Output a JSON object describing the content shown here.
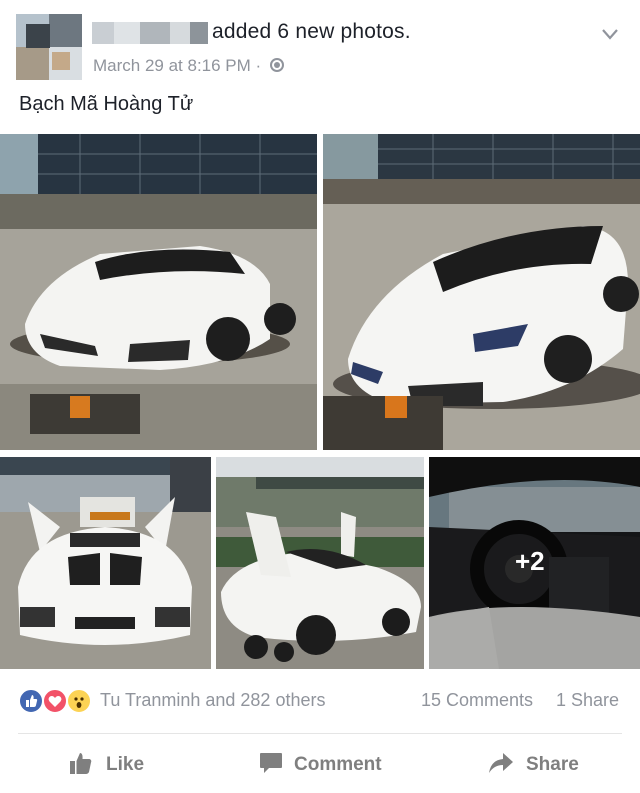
{
  "post": {
    "author_obscured": true,
    "action_text": "added 6 new photos.",
    "timestamp": "March 29 at 8:16 PM",
    "separator": "·",
    "privacy_icon": "globe-icon",
    "menu_icon": "chevron-down-icon",
    "caption": "Bạch Mã Hoàng Tử"
  },
  "photos": {
    "count_shown": 5,
    "overlay_text": "+2"
  },
  "stats": {
    "reaction_icons": [
      "like-icon",
      "love-icon",
      "wow-icon"
    ],
    "reactors": "Tu Tranminh and 282 others",
    "comments": "15 Comments",
    "shares": "1 Share"
  },
  "actions": {
    "like": "Like",
    "comment": "Comment",
    "share": "Share"
  },
  "colors": {
    "like_blue": "#4267b2",
    "love_red": "#f25268",
    "wow_yellow": "#fcd354",
    "meta_gray": "#90949c"
  }
}
